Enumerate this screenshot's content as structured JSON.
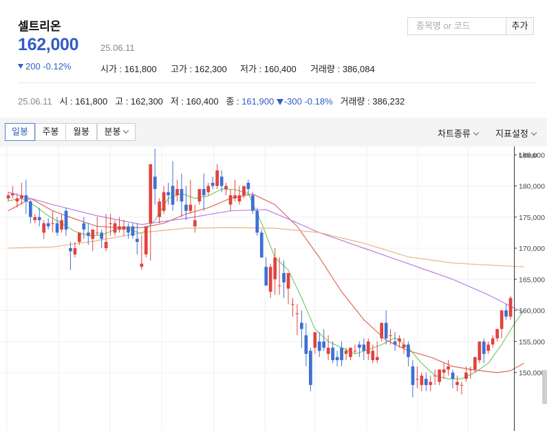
{
  "stock": {
    "name": "셀트리온",
    "price": "162,000",
    "date": "25.06.11",
    "change": "200 -0.12%",
    "open": "시가 : 161,800",
    "high": "고가 : 162,300",
    "low": "저가 : 160,400",
    "volume": "거래량 : 386,084"
  },
  "search": {
    "placeholder": "종목명 or 코드",
    "add_label": "추가"
  },
  "ohlc_row": {
    "date": "25.06.11",
    "open": "시 : 161,800",
    "high": "고 : 162,300",
    "low": "저 : 160,400",
    "close_label": "종 : ",
    "close_value": "161,900",
    "change": "-300 -0.18%",
    "volume": "거래량 : 386,232"
  },
  "toolbar": {
    "tabs": [
      "일봉",
      "주봉",
      "월봉",
      "분봉"
    ],
    "active_tab": "일봉",
    "chart_type": "차트종류",
    "indicator_settings": "지표설정"
  },
  "colors": {
    "up": "#e0433f",
    "down": "#3f6fd1",
    "ma5": "#7ec86c",
    "ma20": "#e0695a",
    "ma60": "#b97fe0",
    "ma120": "#eab383",
    "accent": "#2f5dc6"
  },
  "chart_data": {
    "type": "candlestick",
    "scale_label": "Linear",
    "ylim": [
      145000,
      187000
    ],
    "y_ticks": [
      {
        "v": 185000,
        "label": "185,000"
      },
      {
        "v": 180000,
        "label": "180,000"
      },
      {
        "v": 175000,
        "label": "175,000"
      },
      {
        "v": 170000,
        "label": "170,000"
      },
      {
        "v": 165000,
        "label": "165,000"
      },
      {
        "v": 160000,
        "label": "160,000"
      },
      {
        "v": 155000,
        "label": "155,000"
      },
      {
        "v": 150000,
        "label": "150,000"
      }
    ],
    "candles": [
      [
        178000,
        179000,
        178500,
        177500
      ],
      [
        178500,
        180000,
        178800,
        178000
      ],
      [
        177500,
        178800,
        178000,
        176500
      ],
      [
        178000,
        180500,
        178500,
        177000
      ],
      [
        178500,
        181000,
        177500,
        175500
      ],
      [
        177500,
        177800,
        175000,
        174000
      ],
      [
        174500,
        175500,
        175000,
        174000
      ],
      [
        175000,
        176500,
        174500,
        173500
      ],
      [
        172500,
        174500,
        174000,
        171500
      ],
      [
        174000,
        174800,
        173500,
        173000
      ],
      [
        174000,
        176000,
        174000,
        172500
      ],
      [
        174000,
        175000,
        172500,
        172000
      ],
      [
        173000,
        175500,
        174500,
        172500
      ],
      [
        176000,
        176500,
        173000,
        172000
      ],
      [
        170000,
        171000,
        169500,
        166500
      ],
      [
        169000,
        171000,
        170000,
        168500
      ],
      [
        171000,
        172000,
        172500,
        170500
      ],
      [
        174000,
        175000,
        173000,
        171500
      ],
      [
        172500,
        174000,
        172000,
        170500
      ],
      [
        171500,
        173000,
        173000,
        169500
      ],
      [
        172500,
        175000,
        172500,
        172000
      ],
      [
        172500,
        173000,
        171500,
        170000
      ],
      [
        170000,
        175500,
        171000,
        169500
      ],
      [
        174000,
        175500,
        174000,
        172000
      ],
      [
        172500,
        174500,
        174000,
        172000
      ],
      [
        173000,
        175000,
        173500,
        172500
      ],
      [
        173000,
        174500,
        173500,
        172000
      ],
      [
        173500,
        174000,
        172500,
        171500
      ],
      [
        173500,
        174000,
        172000,
        171500
      ],
      [
        171500,
        174000,
        171000,
        169000
      ],
      [
        167000,
        172000,
        167500,
        166500
      ],
      [
        169000,
        171500,
        173500,
        168500
      ],
      [
        174000,
        182000,
        183500,
        168000
      ],
      [
        181500,
        186000,
        179500,
        177000
      ],
      [
        175000,
        178000,
        177500,
        174000
      ],
      [
        176000,
        180000,
        179000,
        175500
      ],
      [
        179000,
        180500,
        178500,
        177000
      ],
      [
        180000,
        184000,
        177000,
        176000
      ],
      [
        178500,
        181000,
        179500,
        177500
      ],
      [
        179500,
        182000,
        177500,
        175000
      ],
      [
        177000,
        180000,
        176000,
        174500
      ],
      [
        176000,
        181000,
        177000,
        175500
      ],
      [
        173500,
        177000,
        174500,
        172500
      ],
      [
        177500,
        178500,
        179500,
        177000
      ],
      [
        179500,
        182000,
        178500,
        176000
      ],
      [
        179000,
        180500,
        180000,
        178500
      ],
      [
        180500,
        181500,
        180000,
        179500
      ],
      [
        180000,
        183500,
        182500,
        179500
      ],
      [
        181500,
        182500,
        180000,
        179000
      ],
      [
        179500,
        180500,
        180000,
        178500
      ],
      [
        177000,
        179500,
        178500,
        176000
      ],
      [
        178000,
        181000,
        178500,
        177500
      ],
      [
        177500,
        180000,
        178500,
        177000
      ],
      [
        178500,
        179500,
        180000,
        178000
      ],
      [
        180500,
        181000,
        179500,
        178500
      ],
      [
        178500,
        179000,
        176000,
        175500
      ],
      [
        176000,
        176500,
        172500,
        172000
      ],
      [
        172500,
        173000,
        168500,
        168500
      ],
      [
        167000,
        168500,
        164000,
        164000
      ],
      [
        163000,
        167500,
        167000,
        162000
      ],
      [
        165000,
        170000,
        168500,
        162500
      ],
      [
        164000,
        168500,
        164000,
        162500
      ],
      [
        166000,
        168000,
        164500,
        162000
      ],
      [
        163500,
        166000,
        166000,
        161000
      ],
      [
        161000,
        162000,
        161000,
        159000
      ],
      [
        159500,
        161000,
        159500,
        156000
      ],
      [
        158000,
        160000,
        157000,
        154000
      ],
      [
        156000,
        158000,
        153000,
        151000
      ],
      [
        153500,
        154000,
        148000,
        147000
      ],
      [
        154000,
        156000,
        156500,
        153000
      ],
      [
        155000,
        156500,
        153500,
        152500
      ],
      [
        155000,
        157000,
        154000,
        153500
      ],
      [
        153000,
        156000,
        154000,
        152000
      ],
      [
        154000,
        155000,
        152000,
        151500
      ],
      [
        152500,
        153500,
        152000,
        151000
      ],
      [
        154000,
        155000,
        152000,
        151000
      ],
      [
        153000,
        154000,
        153500,
        152000
      ],
      [
        152500,
        154000,
        154000,
        152000
      ],
      [
        153500,
        154500,
        153500,
        153000
      ],
      [
        154500,
        155000,
        154000,
        152500
      ],
      [
        154500,
        155500,
        153500,
        152000
      ],
      [
        153000,
        155500,
        155000,
        152000
      ],
      [
        152000,
        154500,
        153500,
        151500
      ],
      [
        152000,
        155000,
        152500,
        151500
      ],
      [
        155500,
        158000,
        158000,
        155000
      ],
      [
        158000,
        160000,
        155500,
        154500
      ],
      [
        156000,
        157000,
        156000,
        154500
      ],
      [
        155000,
        156500,
        154500,
        153500
      ],
      [
        155000,
        156000,
        155500,
        154000
      ],
      [
        154000,
        155500,
        154500,
        153000
      ],
      [
        154500,
        155000,
        152500,
        151000
      ],
      [
        151000,
        152000,
        148000,
        146000
      ],
      [
        149000,
        151000,
        149000,
        147500
      ],
      [
        148000,
        150000,
        149500,
        147000
      ],
      [
        149000,
        150000,
        148000,
        147000
      ],
      [
        148000,
        149500,
        148500,
        147000
      ],
      [
        149500,
        150500,
        149500,
        148000
      ],
      [
        148500,
        150500,
        150500,
        148000
      ],
      [
        150000,
        151500,
        150500,
        149000
      ],
      [
        150500,
        152000,
        151000,
        149500
      ],
      [
        150000,
        150500,
        149000,
        147500
      ],
      [
        148000,
        149500,
        148500,
        147000
      ],
      [
        148000,
        148500,
        148000,
        146500
      ],
      [
        149000,
        151000,
        150000,
        148500
      ],
      [
        150500,
        151000,
        150500,
        149000
      ],
      [
        150500,
        152000,
        152500,
        150000
      ],
      [
        152000,
        155000,
        155000,
        151500
      ],
      [
        155000,
        155500,
        153000,
        151500
      ],
      [
        153500,
        155000,
        154500,
        153000
      ],
      [
        154500,
        156000,
        155500,
        154000
      ],
      [
        155500,
        157000,
        157000,
        155000
      ],
      [
        157000,
        158500,
        160000,
        155500
      ],
      [
        160000,
        161000,
        159000,
        158500
      ],
      [
        159000,
        162300,
        162000,
        158500
      ]
    ],
    "moving_averages": [
      {
        "name": "5",
        "values": [
          [
            0,
            177600
          ],
          [
            3,
            178000
          ],
          [
            6,
            176800
          ],
          [
            9,
            175200
          ],
          [
            12,
            174000
          ],
          [
            15,
            172700
          ],
          [
            18,
            172000
          ],
          [
            21,
            172100
          ],
          [
            24,
            173000
          ],
          [
            27,
            173100
          ],
          [
            30,
            172300
          ],
          [
            33,
            174500
          ],
          [
            36,
            178000
          ],
          [
            39,
            178800
          ],
          [
            42,
            178000
          ],
          [
            45,
            178400
          ],
          [
            48,
            179500
          ],
          [
            51,
            179400
          ],
          [
            54,
            178800
          ],
          [
            57,
            174000
          ],
          [
            60,
            168500
          ],
          [
            63,
            166500
          ],
          [
            66,
            162000
          ],
          [
            69,
            157000
          ],
          [
            72,
            155000
          ],
          [
            75,
            154000
          ],
          [
            78,
            153000
          ],
          [
            81,
            153700
          ],
          [
            84,
            154500
          ],
          [
            87,
            155600
          ],
          [
            90,
            154000
          ],
          [
            93,
            151500
          ],
          [
            96,
            149500
          ],
          [
            99,
            149000
          ],
          [
            102,
            149000
          ],
          [
            105,
            150000
          ],
          [
            108,
            151500
          ],
          [
            111,
            154500
          ],
          [
            114,
            158000
          ],
          [
            116,
            160000
          ]
        ]
      },
      {
        "name": "20",
        "values": [
          [
            0,
            176000
          ],
          [
            5,
            178000
          ],
          [
            10,
            176000
          ],
          [
            15,
            174700
          ],
          [
            20,
            173500
          ],
          [
            25,
            173300
          ],
          [
            30,
            173300
          ],
          [
            35,
            174000
          ],
          [
            40,
            175500
          ],
          [
            45,
            176500
          ],
          [
            50,
            178000
          ],
          [
            55,
            178700
          ],
          [
            60,
            177000
          ],
          [
            65,
            173500
          ],
          [
            70,
            168500
          ],
          [
            75,
            163000
          ],
          [
            80,
            158500
          ],
          [
            85,
            155200
          ],
          [
            90,
            153500
          ],
          [
            95,
            152500
          ],
          [
            100,
            151000
          ],
          [
            105,
            150400
          ],
          [
            110,
            150000
          ],
          [
            113,
            150300
          ],
          [
            116,
            151500
          ]
        ]
      },
      {
        "name": "60",
        "values": [
          [
            0,
            179000
          ],
          [
            10,
            177000
          ],
          [
            20,
            175200
          ],
          [
            30,
            173800
          ],
          [
            40,
            174800
          ],
          [
            50,
            176000
          ],
          [
            58,
            176200
          ],
          [
            62,
            175000
          ],
          [
            70,
            172500
          ],
          [
            80,
            170000
          ],
          [
            90,
            167500
          ],
          [
            100,
            165000
          ],
          [
            108,
            162500
          ],
          [
            114,
            160300
          ],
          [
            116,
            159700
          ]
        ]
      },
      {
        "name": "120",
        "values": [
          [
            0,
            170000
          ],
          [
            10,
            170200
          ],
          [
            20,
            171200
          ],
          [
            30,
            172500
          ],
          [
            40,
            173200
          ],
          [
            50,
            173300
          ],
          [
            60,
            173200
          ],
          [
            70,
            172500
          ],
          [
            80,
            170800
          ],
          [
            90,
            168600
          ],
          [
            100,
            167600
          ],
          [
            110,
            167200
          ],
          [
            116,
            167000
          ]
        ]
      }
    ]
  }
}
